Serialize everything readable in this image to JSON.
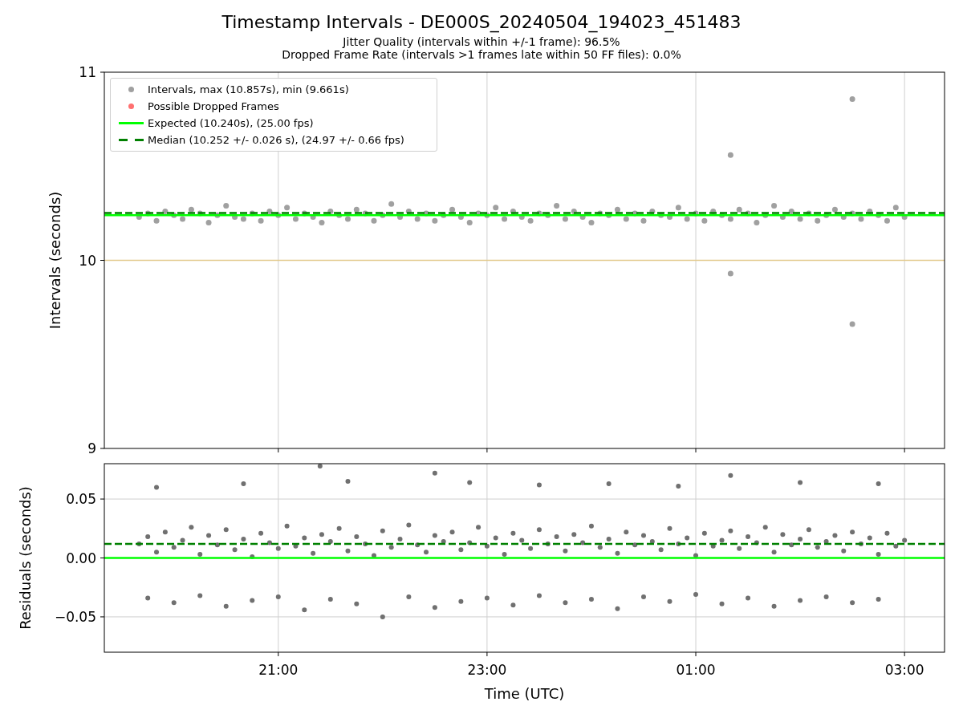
{
  "title": "Timestamp Intervals - DE000S_20240504_194023_451483",
  "subtitles": [
    "Jitter Quality (intervals within +/-1 frame): 96.5%",
    "Dropped Frame Rate (intervals >1 frames late within 50 FF files): 0.0%"
  ],
  "intervals_plot": {
    "legend": [
      {
        "kind": "dot",
        "label": "Intervals, max (10.857s), min (9.661s)",
        "color": "#a0a0a0"
      },
      {
        "kind": "dot",
        "label": "Possible Dropped Frames",
        "color": "#ff7070"
      },
      {
        "kind": "line",
        "label": "Expected (10.240s), (25.00 fps)",
        "color": "#00ff00"
      },
      {
        "kind": "dashed",
        "label": "Median (10.252 +/- 0.026 s), (24.97 +/- 0.66 fps)",
        "color": "#008000"
      }
    ],
    "chart_data": {
      "type": "scatter",
      "ylabel": "Intervals (seconds)",
      "xlim": [
        "2024-05-04T19:20",
        "2024-05-05T03:23"
      ],
      "ylim": [
        9,
        11
      ],
      "yticks": [
        {
          "value": 9,
          "label": "9"
        },
        {
          "value": 10,
          "label": "10"
        },
        {
          "value": 11,
          "label": "11"
        }
      ],
      "grid": "x",
      "series": [
        {
          "type": "scatter",
          "color": "#a0a0a0",
          "x": [
            "2024-05-04T19:40",
            "2024-05-04T19:45",
            "2024-05-04T19:50",
            "2024-05-04T19:55",
            "2024-05-04T20:00",
            "2024-05-04T20:05",
            "2024-05-04T20:10",
            "2024-05-04T20:15",
            "2024-05-04T20:20",
            "2024-05-04T20:25",
            "2024-05-04T20:30",
            "2024-05-04T20:35",
            "2024-05-04T20:40",
            "2024-05-04T20:45",
            "2024-05-04T20:50",
            "2024-05-04T20:55",
            "2024-05-04T21:00",
            "2024-05-04T21:05",
            "2024-05-04T21:10",
            "2024-05-04T21:15",
            "2024-05-04T21:20",
            "2024-05-04T21:25",
            "2024-05-04T21:30",
            "2024-05-04T21:35",
            "2024-05-04T21:40",
            "2024-05-04T21:45",
            "2024-05-04T21:50",
            "2024-05-04T21:55",
            "2024-05-04T22:00",
            "2024-05-04T22:05",
            "2024-05-04T22:10",
            "2024-05-04T22:15",
            "2024-05-04T22:20",
            "2024-05-04T22:25",
            "2024-05-04T22:30",
            "2024-05-04T22:35",
            "2024-05-04T22:40",
            "2024-05-04T22:45",
            "2024-05-04T22:50",
            "2024-05-04T22:55",
            "2024-05-04T23:00",
            "2024-05-04T23:05",
            "2024-05-04T23:10",
            "2024-05-04T23:15",
            "2024-05-04T23:20",
            "2024-05-04T23:25",
            "2024-05-04T23:30",
            "2024-05-04T23:35",
            "2024-05-04T23:40",
            "2024-05-04T23:45",
            "2024-05-04T23:50",
            "2024-05-04T23:55",
            "2024-05-05T00:00",
            "2024-05-05T00:05",
            "2024-05-05T00:10",
            "2024-05-05T00:15",
            "2024-05-05T00:20",
            "2024-05-05T00:25",
            "2024-05-05T00:30",
            "2024-05-05T00:35",
            "2024-05-05T00:40",
            "2024-05-05T00:45",
            "2024-05-05T00:50",
            "2024-05-05T00:55",
            "2024-05-05T01:00",
            "2024-05-05T01:05",
            "2024-05-05T01:10",
            "2024-05-05T01:15",
            "2024-05-05T01:20",
            "2024-05-05T01:25",
            "2024-05-05T01:30",
            "2024-05-05T01:35",
            "2024-05-05T01:40",
            "2024-05-05T01:45",
            "2024-05-05T01:50",
            "2024-05-05T01:55",
            "2024-05-05T02:00",
            "2024-05-05T02:05",
            "2024-05-05T02:10",
            "2024-05-05T02:15",
            "2024-05-05T02:20",
            "2024-05-05T02:25",
            "2024-05-05T02:30",
            "2024-05-05T02:35",
            "2024-05-05T02:40",
            "2024-05-05T02:45",
            "2024-05-05T02:50",
            "2024-05-05T02:55",
            "2024-05-05T03:00"
          ],
          "values": [
            10.23,
            10.25,
            10.21,
            10.26,
            10.24,
            10.22,
            10.27,
            10.25,
            10.2,
            10.24,
            10.29,
            10.23,
            10.22,
            10.25,
            10.21,
            10.26,
            10.24,
            10.28,
            10.22,
            10.25,
            10.23,
            10.2,
            10.26,
            10.24,
            10.22,
            10.27,
            10.25,
            10.21,
            10.24,
            10.3,
            10.23,
            10.26,
            10.22,
            10.25,
            10.21,
            10.24,
            10.27,
            10.23,
            10.2,
            10.25,
            10.24,
            10.28,
            10.22,
            10.26,
            10.23,
            10.21,
            10.25,
            10.24,
            10.29,
            10.22,
            10.26,
            10.23,
            10.2,
            10.25,
            10.24,
            10.27,
            10.22,
            10.25,
            10.21,
            10.26,
            10.24,
            10.23,
            10.28,
            10.22,
            10.25,
            10.21,
            10.26,
            10.24,
            10.22,
            10.27,
            10.25,
            10.2,
            10.24,
            10.29,
            10.23,
            10.26,
            10.22,
            10.25,
            10.21,
            10.24,
            10.27,
            10.23,
            10.25,
            10.22,
            10.26,
            10.24,
            10.21,
            10.28,
            10.23
          ]
        },
        {
          "type": "scatter",
          "color": "#a0a0a0",
          "x": [
            "2024-05-05T01:20",
            "2024-05-05T01:20",
            "2024-05-05T02:30",
            "2024-05-05T02:30"
          ],
          "values": [
            10.56,
            9.93,
            10.857,
            9.661
          ]
        },
        {
          "type": "line",
          "color": "#e2c98c",
          "x": [
            "2024-05-04T19:20",
            "2024-05-05T03:23"
          ],
          "values": [
            10,
            10
          ]
        },
        {
          "type": "line",
          "color": "#00ff00",
          "x": [
            "2024-05-04T19:20",
            "2024-05-05T03:23"
          ],
          "values": [
            10.24,
            10.24
          ]
        },
        {
          "type": "line",
          "color": "#008000",
          "line_style": "dashed",
          "x": [
            "2024-05-04T19:20",
            "2024-05-05T03:23"
          ],
          "values": [
            10.252,
            10.252
          ]
        }
      ]
    }
  },
  "residuals_plot": {
    "chart_data": {
      "type": "scatter",
      "xlabel": "Time (UTC)",
      "ylabel": "Residuals (seconds)",
      "xlim": [
        "2024-05-04T19:20",
        "2024-05-05T03:23"
      ],
      "ylim": [
        -0.08,
        0.08
      ],
      "grid": "both",
      "xticks": [
        {
          "value": "2024-05-04T21:00",
          "label": "21:00"
        },
        {
          "value": "2024-05-04T23:00",
          "label": "23:00"
        },
        {
          "value": "2024-05-05T01:00",
          "label": "01:00"
        },
        {
          "value": "2024-05-05T03:00",
          "label": "03:00"
        }
      ],
      "yticks": [
        {
          "value": 0.05,
          "label": "0.05"
        },
        {
          "value": 0,
          "label": "0.00"
        },
        {
          "value": -0.05,
          "label": "−0.05"
        }
      ],
      "series": [
        {
          "type": "scatter",
          "color": "#707070",
          "x": [
            "2024-05-04T19:40",
            "2024-05-04T19:45",
            "2024-05-04T19:50",
            "2024-05-04T19:55",
            "2024-05-04T20:00",
            "2024-05-04T20:05",
            "2024-05-04T20:10",
            "2024-05-04T20:15",
            "2024-05-04T20:20",
            "2024-05-04T20:25",
            "2024-05-04T20:30",
            "2024-05-04T20:35",
            "2024-05-04T20:40",
            "2024-05-04T20:45",
            "2024-05-04T20:50",
            "2024-05-04T20:55",
            "2024-05-04T21:00",
            "2024-05-04T21:05",
            "2024-05-04T21:10",
            "2024-05-04T21:15",
            "2024-05-04T21:20",
            "2024-05-04T21:25",
            "2024-05-04T21:30",
            "2024-05-04T21:35",
            "2024-05-04T21:40",
            "2024-05-04T21:45",
            "2024-05-04T21:50",
            "2024-05-04T21:55",
            "2024-05-04T22:00",
            "2024-05-04T22:05",
            "2024-05-04T22:10",
            "2024-05-04T22:15",
            "2024-05-04T22:20",
            "2024-05-04T22:25",
            "2024-05-04T22:30",
            "2024-05-04T22:35",
            "2024-05-04T22:40",
            "2024-05-04T22:45",
            "2024-05-04T22:50",
            "2024-05-04T22:55",
            "2024-05-04T23:00",
            "2024-05-04T23:05",
            "2024-05-04T23:10",
            "2024-05-04T23:15",
            "2024-05-04T23:20",
            "2024-05-04T23:25",
            "2024-05-04T23:30",
            "2024-05-04T23:35",
            "2024-05-04T23:40",
            "2024-05-04T23:45",
            "2024-05-04T23:50",
            "2024-05-04T23:55",
            "2024-05-05T00:00",
            "2024-05-05T00:05",
            "2024-05-05T00:10",
            "2024-05-05T00:15",
            "2024-05-05T00:20",
            "2024-05-05T00:25",
            "2024-05-05T00:30",
            "2024-05-05T00:35",
            "2024-05-05T00:40",
            "2024-05-05T00:45",
            "2024-05-05T00:50",
            "2024-05-05T00:55",
            "2024-05-05T01:00",
            "2024-05-05T01:05",
            "2024-05-05T01:10",
            "2024-05-05T01:15",
            "2024-05-05T01:20",
            "2024-05-05T01:25",
            "2024-05-05T01:30",
            "2024-05-05T01:35",
            "2024-05-05T01:40",
            "2024-05-05T01:45",
            "2024-05-05T01:50",
            "2024-05-05T01:55",
            "2024-05-05T02:00",
            "2024-05-05T02:05",
            "2024-05-05T02:10",
            "2024-05-05T02:15",
            "2024-05-05T02:20",
            "2024-05-05T02:25",
            "2024-05-05T02:30",
            "2024-05-05T02:35",
            "2024-05-05T02:40",
            "2024-05-05T02:45",
            "2024-05-05T02:50",
            "2024-05-05T02:55",
            "2024-05-05T03:00"
          ],
          "values": [
            0.012,
            0.018,
            0.005,
            0.022,
            0.009,
            0.015,
            0.026,
            0.003,
            0.019,
            0.011,
            0.024,
            0.007,
            0.016,
            0.001,
            0.021,
            0.013,
            0.008,
            0.027,
            0.01,
            0.017,
            0.004,
            0.02,
            0.014,
            0.025,
            0.006,
            0.018,
            0.012,
            0.002,
            0.023,
            0.009,
            0.016,
            0.028,
            0.011,
            0.005,
            0.019,
            0.014,
            0.022,
            0.007,
            0.013,
            0.026,
            0.01,
            0.017,
            0.003,
            0.021,
            0.015,
            0.008,
            0.024,
            0.012,
            0.018,
            0.006,
            0.02,
            0.013,
            0.027,
            0.009,
            0.016,
            0.004,
            0.022,
            0.011,
            0.019,
            0.014,
            0.007,
            0.025,
            0.012,
            0.017,
            0.002,
            0.021,
            0.01,
            0.015,
            0.023,
            0.008,
            0.018,
            0.013,
            0.026,
            0.005,
            0.02,
            0.011,
            0.016,
            0.024,
            0.009,
            0.014,
            0.019,
            0.006,
            0.022,
            0.012,
            0.017,
            0.003,
            0.021,
            0.01,
            0.015
          ]
        },
        {
          "type": "scatter",
          "color": "#707070",
          "x": [
            "2024-05-04T19:45",
            "2024-05-04T20:00",
            "2024-05-04T20:15",
            "2024-05-04T20:30",
            "2024-05-04T20:45",
            "2024-05-04T21:00",
            "2024-05-04T21:15",
            "2024-05-04T21:30",
            "2024-05-04T21:45",
            "2024-05-04T22:00",
            "2024-05-04T22:15",
            "2024-05-04T22:30",
            "2024-05-04T22:45",
            "2024-05-04T23:00",
            "2024-05-04T23:15",
            "2024-05-04T23:30",
            "2024-05-04T23:45",
            "2024-05-05T00:00",
            "2024-05-05T00:15",
            "2024-05-05T00:30",
            "2024-05-05T00:45",
            "2024-05-05T01:00",
            "2024-05-05T01:15",
            "2024-05-05T01:30",
            "2024-05-05T01:45",
            "2024-05-05T02:00",
            "2024-05-05T02:15",
            "2024-05-05T02:30",
            "2024-05-05T02:45"
          ],
          "values": [
            -0.034,
            -0.038,
            -0.032,
            -0.041,
            -0.036,
            -0.033,
            -0.044,
            -0.035,
            -0.039,
            -0.05,
            -0.033,
            -0.042,
            -0.037,
            -0.034,
            -0.04,
            -0.032,
            -0.038,
            -0.035,
            -0.043,
            -0.033,
            -0.037,
            -0.031,
            -0.039,
            -0.034,
            -0.041,
            -0.036,
            -0.033,
            -0.038,
            -0.035
          ]
        },
        {
          "type": "scatter",
          "color": "#707070",
          "x": [
            "2024-05-04T19:50",
            "2024-05-04T20:40",
            "2024-05-04T21:24",
            "2024-05-04T21:40",
            "2024-05-04T22:30",
            "2024-05-04T22:50",
            "2024-05-04T23:30",
            "2024-05-05T00:10",
            "2024-05-05T00:50",
            "2024-05-05T01:20",
            "2024-05-05T02:00",
            "2024-05-05T02:45"
          ],
          "values": [
            0.06,
            0.063,
            0.078,
            0.065,
            0.072,
            0.064,
            0.062,
            0.063,
            0.061,
            0.07,
            0.064,
            0.063
          ]
        },
        {
          "type": "line",
          "color": "#00ff00",
          "x": [
            "2024-05-04T19:20",
            "2024-05-05T03:23"
          ],
          "values": [
            0,
            0
          ]
        },
        {
          "type": "line",
          "color": "#008000",
          "line_style": "dashed",
          "x": [
            "2024-05-04T19:20",
            "2024-05-05T03:23"
          ],
          "values": [
            0.012,
            0.012
          ]
        }
      ]
    }
  }
}
